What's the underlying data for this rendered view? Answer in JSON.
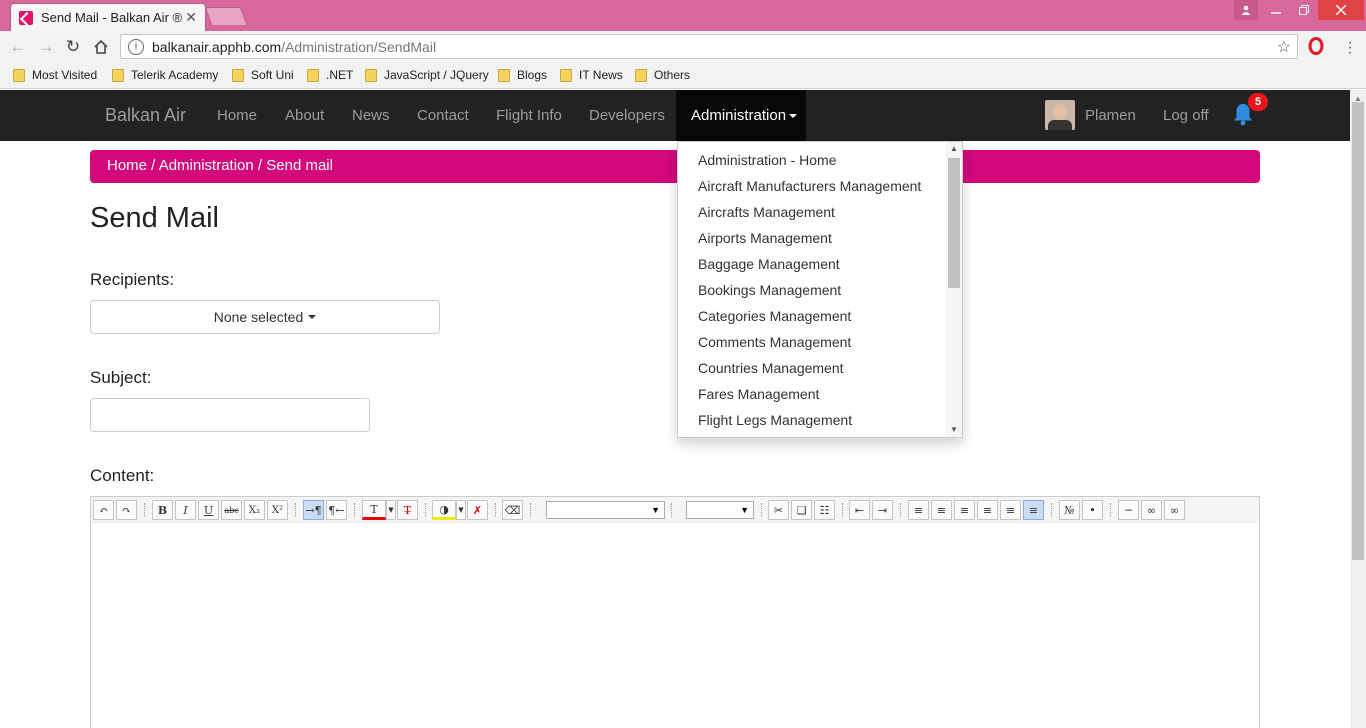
{
  "browser": {
    "tab_title": "Send Mail - Balkan Air ®",
    "tab_close": "✕",
    "url_host": "balkanair.apphb.com",
    "url_path": "/Administration/SendMail",
    "bookmarks": [
      "Most Visited",
      "Telerik Academy",
      "Soft Uni",
      ".NET",
      "JavaScript / JQuery",
      "Blogs",
      "IT News",
      "Others"
    ]
  },
  "navbar": {
    "brand": "Balkan Air",
    "links": [
      "Home",
      "About",
      "News",
      "Contact",
      "Flight Info",
      "Developers"
    ],
    "active": "Administration",
    "user": "Plamen",
    "logoff": "Log off",
    "notifications": "5"
  },
  "dropdown": {
    "items": [
      "Administration - Home",
      "Aircraft Manufacturers Management",
      "Aircrafts Management",
      "Airports Management",
      "Baggage Management",
      "Bookings Management",
      "Categories Management",
      "Comments Management",
      "Countries Management",
      "Fares Management",
      "Flight Legs Management"
    ]
  },
  "breadcrumb": {
    "home": "Home",
    "admin": "Administration",
    "current": "Send mail",
    "sep1": " / ",
    "sep2": " / "
  },
  "page": {
    "title": "Send Mail",
    "recipients_label": "Recipients:",
    "recipients_value": "None selected",
    "subject_label": "Subject:",
    "content_label": "Content:"
  },
  "colors": {
    "accent": "#d2087b",
    "navbar": "#222222",
    "chrome": "#d8689b"
  }
}
